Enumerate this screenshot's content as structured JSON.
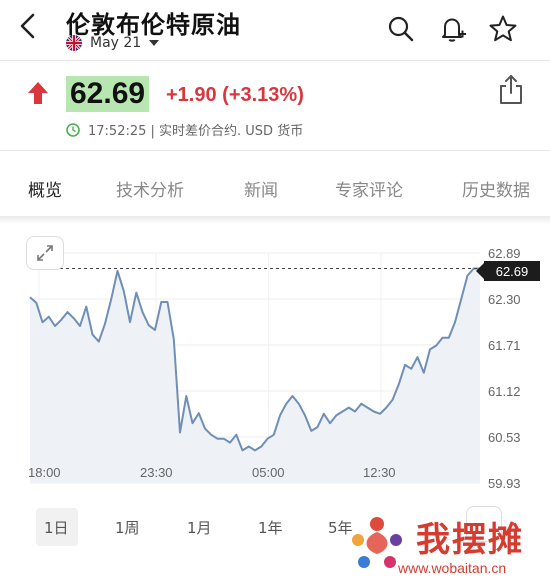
{
  "header": {
    "title": "伦敦布伦特原油",
    "date": "May 21"
  },
  "quote": {
    "price": "62.69",
    "change": "+1.90 (+3.13%)",
    "status": "17:52:25 | 实时差价合约. USD 货币",
    "direction_color": "#d9363e"
  },
  "tabs": [
    {
      "label": "概览",
      "active": true
    },
    {
      "label": "技术分析",
      "active": false
    },
    {
      "label": "新闻",
      "active": false
    },
    {
      "label": "专家评论",
      "active": false
    },
    {
      "label": "历史数据",
      "active": false
    }
  ],
  "chart_data": {
    "type": "line",
    "series": [
      {
        "values": [
          62.32,
          62.25,
          62.0,
          62.07,
          61.95,
          62.03,
          62.13,
          62.05,
          61.95,
          62.2,
          61.84,
          61.75,
          61.98,
          62.3,
          62.66,
          62.4,
          62.0,
          62.38,
          62.13,
          61.96,
          61.9,
          62.26,
          62.26,
          61.78,
          60.58,
          61.05,
          60.7,
          60.83,
          60.63,
          60.55,
          60.5,
          60.5,
          60.45,
          60.55,
          60.35,
          60.4,
          60.35,
          60.4,
          60.5,
          60.55,
          60.8,
          60.95,
          61.05,
          60.95,
          60.8,
          60.6,
          60.65,
          60.82,
          60.7,
          60.8,
          60.85,
          60.9,
          60.85,
          60.95,
          60.9,
          60.85,
          60.82,
          60.9,
          61.0,
          61.2,
          61.45,
          61.4,
          61.55,
          61.35,
          61.65,
          61.7,
          61.8,
          61.8,
          62.0,
          62.3,
          62.6,
          62.69,
          62.69
        ]
      }
    ],
    "x_tick_labels": [
      "18:00",
      "23:30",
      "05:00",
      "12:30"
    ],
    "y_tick_labels": [
      "62.89",
      "62.30",
      "61.71",
      "61.12",
      "60.53",
      "59.93"
    ],
    "ylim": [
      59.93,
      62.89
    ],
    "current_value": "62.69",
    "line_color": "#6f8fb5",
    "fill_color": "#eef1f6",
    "grid": true
  },
  "periods": [
    {
      "label": "1日",
      "active": true
    },
    {
      "label": "1周",
      "active": false
    },
    {
      "label": "1月",
      "active": false
    },
    {
      "label": "1年",
      "active": false
    },
    {
      "label": "5年",
      "active": false
    }
  ],
  "watermark": {
    "text": "我摆摊",
    "url": "www.wobaitan.cn"
  },
  "icons": [
    "back-arrow-icon",
    "uk-flag-icon",
    "caret-down-icon",
    "search-icon",
    "bell-plus-icon",
    "star-icon",
    "up-arrow-icon",
    "share-icon",
    "clock-icon",
    "expand-icon"
  ]
}
